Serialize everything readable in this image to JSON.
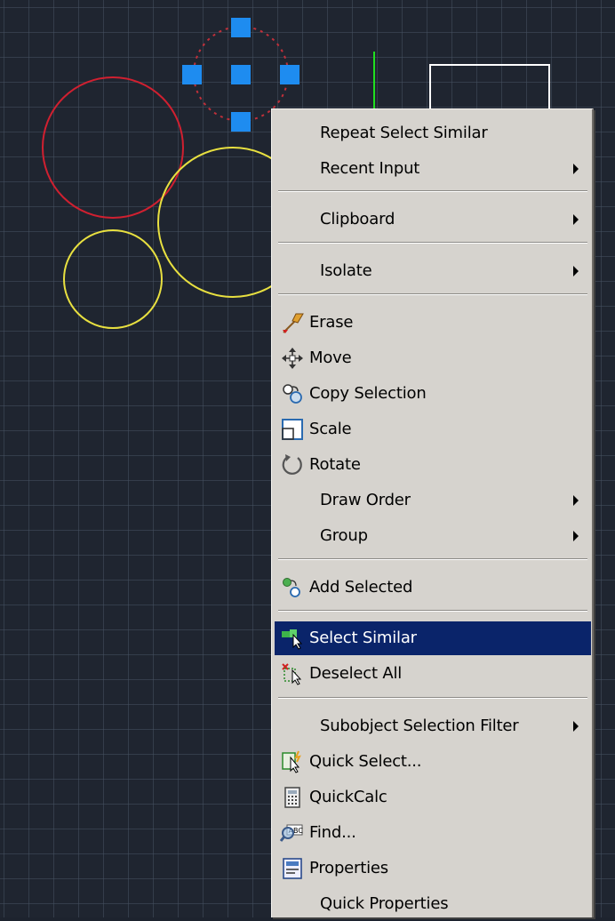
{
  "colors": {
    "canvas_bg": "#1f2530",
    "grip_blue": "#1e8cf0",
    "red_circle": "#d02030",
    "yellow_circle": "#e8e040",
    "green_axis": "#20e020",
    "menu_bg": "#d6d3ce",
    "highlight_bg": "#0a246a"
  },
  "menu": {
    "items": [
      {
        "label": "Repeat Select Similar",
        "icon": null,
        "submenu": false
      },
      {
        "label": "Recent Input",
        "icon": null,
        "submenu": true
      },
      {
        "label": "Clipboard",
        "icon": null,
        "submenu": true
      },
      {
        "label": "Isolate",
        "icon": null,
        "submenu": true
      },
      {
        "label": "Erase",
        "icon": "eraser-icon",
        "submenu": false
      },
      {
        "label": "Move",
        "icon": "move-icon",
        "submenu": false
      },
      {
        "label": "Copy Selection",
        "icon": "copy-selection-icon",
        "submenu": false
      },
      {
        "label": "Scale",
        "icon": "scale-icon",
        "submenu": false
      },
      {
        "label": "Rotate",
        "icon": "rotate-icon",
        "submenu": false
      },
      {
        "label": "Draw Order",
        "icon": null,
        "submenu": true
      },
      {
        "label": "Group",
        "icon": null,
        "submenu": true
      },
      {
        "label": "Add Selected",
        "icon": "add-selected-icon",
        "submenu": false
      },
      {
        "label": "Select Similar",
        "icon": "select-similar-icon",
        "submenu": false,
        "highlighted": true
      },
      {
        "label": "Deselect All",
        "icon": "deselect-all-icon",
        "submenu": false
      },
      {
        "label": "Subobject Selection Filter",
        "icon": null,
        "submenu": true
      },
      {
        "label": "Quick Select...",
        "icon": "quick-select-icon",
        "submenu": false
      },
      {
        "label": "QuickCalc",
        "icon": "calculator-icon",
        "submenu": false
      },
      {
        "label": "Find...",
        "icon": "find-icon",
        "submenu": false
      },
      {
        "label": "Properties",
        "icon": "properties-icon",
        "submenu": false
      },
      {
        "label": "Quick Properties",
        "icon": null,
        "submenu": false
      }
    ]
  }
}
